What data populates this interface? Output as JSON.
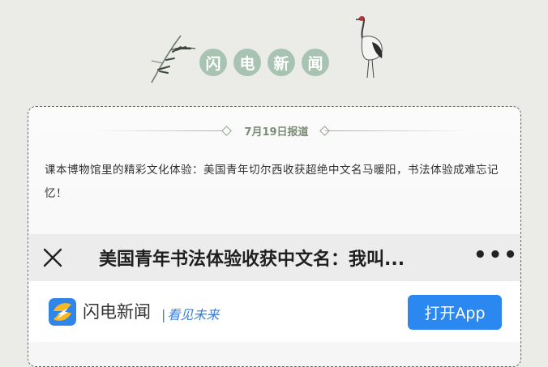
{
  "header": {
    "title_chars": [
      "闪",
      "电",
      "新",
      "闻"
    ],
    "left_decoration": "bamboo-icon",
    "right_decoration": "crane-icon"
  },
  "card": {
    "date_label": "7月19日报道",
    "description": "课本博物馆里的精彩文化体验：美国青年切尔西收获超绝中文名马暖阳，书法体验成难忘记忆！"
  },
  "browser": {
    "close_icon": "close-icon",
    "title": "美国青年书法体验收获中文名：我叫...",
    "more_icon": "more-dots-icon",
    "more_label": "•••"
  },
  "app_banner": {
    "logo_icon": "lightning-logo-icon",
    "app_name": "闪电新闻",
    "slogan_bar": "|",
    "slogan": "看见未来",
    "open_button": "打开App"
  },
  "colors": {
    "page_bg": "#ebece8",
    "title_circle": "#a9c3b3",
    "accent_green": "#7c8d76",
    "button_blue": "#2b88f0",
    "slogan_blue": "#3a7fd8"
  }
}
